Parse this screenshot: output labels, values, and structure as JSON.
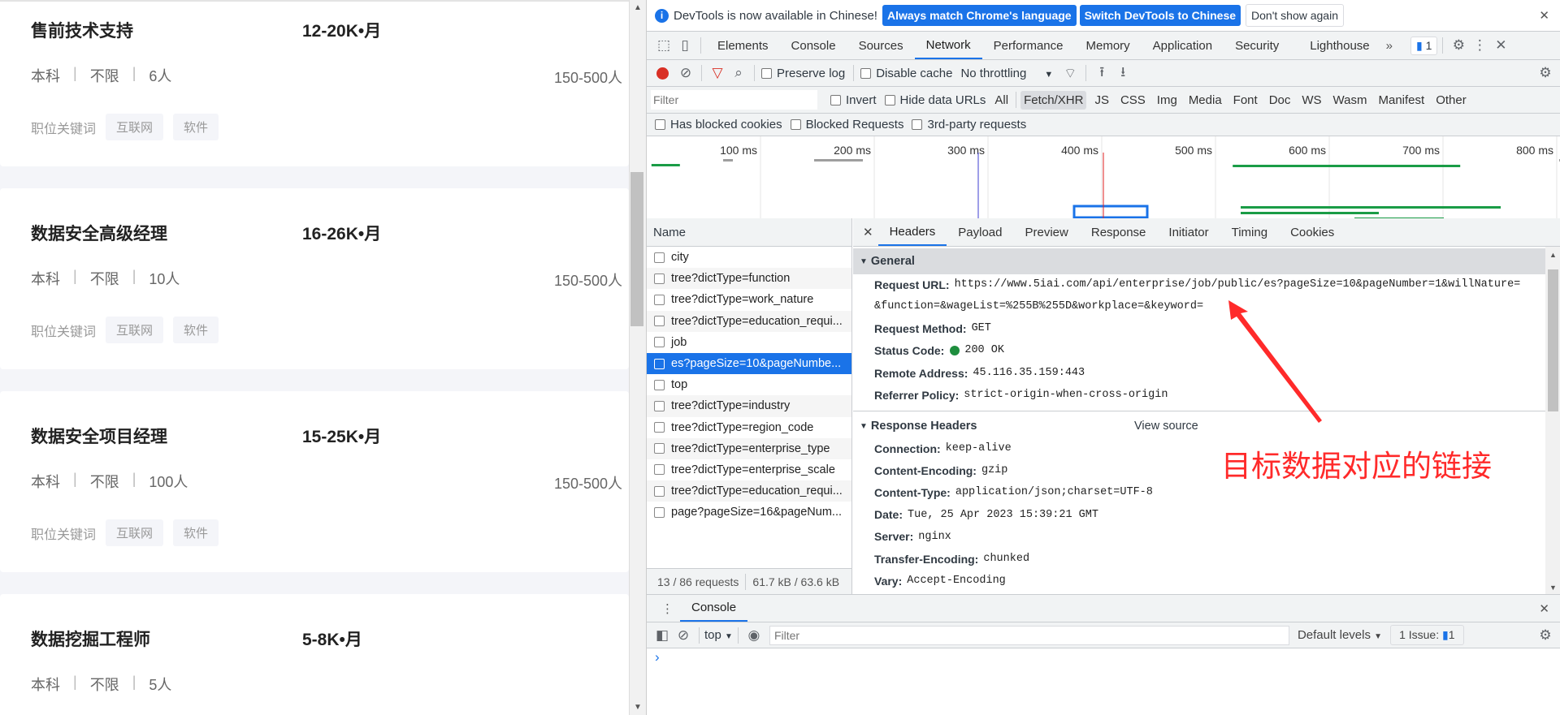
{
  "jobs": [
    {
      "title": "售前技术支持",
      "salary": "12-20K•月",
      "edu": "本科",
      "exp": "不限",
      "count": "6人",
      "size": "150-500人",
      "kw_label": "职位关键词",
      "tags": [
        "互联网",
        "软件"
      ]
    },
    {
      "title": "数据安全高级经理",
      "salary": "16-26K•月",
      "edu": "本科",
      "exp": "不限",
      "count": "10人",
      "size": "150-500人",
      "kw_label": "职位关键词",
      "tags": [
        "互联网",
        "软件"
      ]
    },
    {
      "title": "数据安全项目经理",
      "salary": "15-25K•月",
      "edu": "本科",
      "exp": "不限",
      "count": "100人",
      "size": "150-500人",
      "kw_label": "职位关键词",
      "tags": [
        "互联网",
        "软件"
      ]
    },
    {
      "title": "数据挖掘工程师",
      "salary": "5-8K•月",
      "edu": "本科",
      "exp": "不限",
      "count": "5人",
      "size": "",
      "kw_label": "",
      "tags": []
    }
  ],
  "devtools": {
    "infobar": {
      "message": "DevTools is now available in Chinese!",
      "btn1": "Always match Chrome's language",
      "btn2": "Switch DevTools to Chinese",
      "btn3": "Don't show again"
    },
    "tabs": [
      "Elements",
      "Console",
      "Sources",
      "Network",
      "Performance",
      "Memory",
      "Application",
      "Security",
      "Lighthouse"
    ],
    "active_tab": "Network",
    "issues_count": "1",
    "toolbar": {
      "preserve_log": "Preserve log",
      "disable_cache": "Disable cache",
      "throttling": "No throttling"
    },
    "filter": {
      "placeholder": "Filter",
      "invert": "Invert",
      "hide_data": "Hide data URLs",
      "types": [
        "All",
        "Fetch/XHR",
        "JS",
        "CSS",
        "Img",
        "Media",
        "Font",
        "Doc",
        "WS",
        "Wasm",
        "Manifest",
        "Other"
      ],
      "active_type": "Fetch/XHR"
    },
    "filter2": {
      "blocked_cookies": "Has blocked cookies",
      "blocked_requests": "Blocked Requests",
      "third_party": "3rd-party requests"
    },
    "timeline_ticks": [
      "100 ms",
      "200 ms",
      "300 ms",
      "400 ms",
      "500 ms",
      "600 ms",
      "700 ms",
      "800 ms"
    ],
    "name_header": "Name",
    "requests": [
      "city",
      "tree?dictType=function",
      "tree?dictType=work_nature",
      "tree?dictType=education_requi...",
      "job",
      "es?pageSize=10&pageNumbe...",
      "top",
      "tree?dictType=industry",
      "tree?dictType=region_code",
      "tree?dictType=enterprise_type",
      "tree?dictType=enterprise_scale",
      "tree?dictType=education_requi...",
      "page?pageSize=16&pageNum..."
    ],
    "selected_index": 5,
    "footer": {
      "requests": "13 / 86 requests",
      "size": "61.7 kB / 63.6 kB"
    },
    "detail_tabs": [
      "Headers",
      "Payload",
      "Preview",
      "Response",
      "Initiator",
      "Timing",
      "Cookies"
    ],
    "general": {
      "title": "General",
      "url_label": "Request URL:",
      "url_line1": "https://www.5iai.com/api/enterprise/job/public/es?pageSize=10&pageNumber=1&willNature=",
      "url_line2": "&function=&wageList=%255B%255D&workplace=&keyword=",
      "method_label": "Request Method:",
      "method": "GET",
      "status_label": "Status Code:",
      "status": "200 OK",
      "status_color": "#1e8e3e",
      "remote_label": "Remote Address:",
      "remote": "45.116.35.159:443",
      "referrer_label": "Referrer Policy:",
      "referrer": "strict-origin-when-cross-origin"
    },
    "response_headers": {
      "title": "Response Headers",
      "view_source": "View source",
      "items": [
        {
          "k": "Connection:",
          "v": "keep-alive"
        },
        {
          "k": "Content-Encoding:",
          "v": "gzip"
        },
        {
          "k": "Content-Type:",
          "v": "application/json;charset=UTF-8"
        },
        {
          "k": "Date:",
          "v": "Tue, 25 Apr 2023 15:39:21 GMT"
        },
        {
          "k": "Server:",
          "v": "nginx"
        },
        {
          "k": "Transfer-Encoding:",
          "v": "chunked"
        },
        {
          "k": "Vary:",
          "v": "Accept-Encoding"
        }
      ]
    },
    "drawer": {
      "tab": "Console",
      "context": "top",
      "filter_placeholder": "Filter",
      "levels": "Default levels",
      "issues": "1 Issue:",
      "issues_count": "1",
      "prompt": "›"
    }
  },
  "annotation": {
    "text": "目标数据对应的链接",
    "color": "#ff2a2a"
  },
  "accent": "#1a73e8"
}
